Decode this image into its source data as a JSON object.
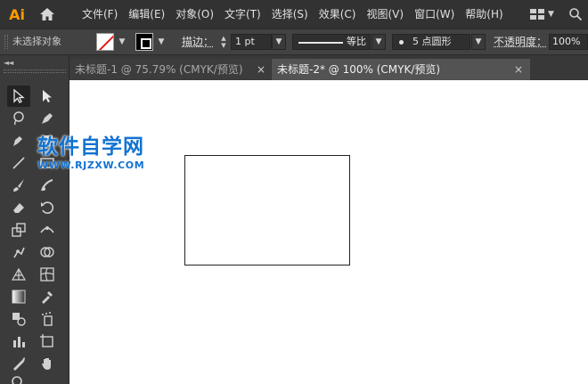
{
  "app": {
    "logo": "Ai"
  },
  "menu": [
    "文件(F)",
    "编辑(E)",
    "对象(O)",
    "文字(T)",
    "选择(S)",
    "效果(C)",
    "视图(V)",
    "窗口(W)",
    "帮助(H)"
  ],
  "control_bar": {
    "selection_status": "未选择对象",
    "stroke_label": "描边：",
    "stroke_weight": "1 pt",
    "stroke_profile": "等比",
    "brush": "5 点圆形",
    "opacity_label": "不透明度：",
    "opacity_value": "100%",
    "fill_color": "#ffffff",
    "stroke_color": "#000000"
  },
  "tabs": [
    {
      "title": "未标题-1 @ 75.79% (CMYK/预览)",
      "active": false,
      "close": "×"
    },
    {
      "title": "未标题-2* @ 100% (CMYK/预览)",
      "active": true,
      "close": "×"
    }
  ],
  "tools": [
    "selection-tool",
    "direct-selection-tool",
    "magic-wand-tool",
    "pen-tool",
    "curvature-tool",
    "type-tool",
    "line-segment-tool",
    "rectangle-tool",
    "paintbrush-tool",
    "shaper-tool",
    "eraser-tool",
    "rotate-tool",
    "width-tool",
    "warp-tool",
    "free-transform-tool",
    "shape-builder-tool",
    "perspective-grid-tool",
    "mesh-tool",
    "gradient-tool",
    "eyedropper-tool",
    "blend-tool",
    "symbol-sprayer-tool",
    "column-graph-tool",
    "artboard-tool",
    "slice-tool",
    "hand-tool",
    "zoom-tool"
  ],
  "watermark": {
    "title": "软件自学网",
    "url": "WWW.RJZXW.COM"
  },
  "colors": {
    "app_bg": "#535353",
    "menubar": "#323232",
    "logo": "#ff9a00",
    "canvas": "#ffffff",
    "watermark": "#1273d0"
  }
}
